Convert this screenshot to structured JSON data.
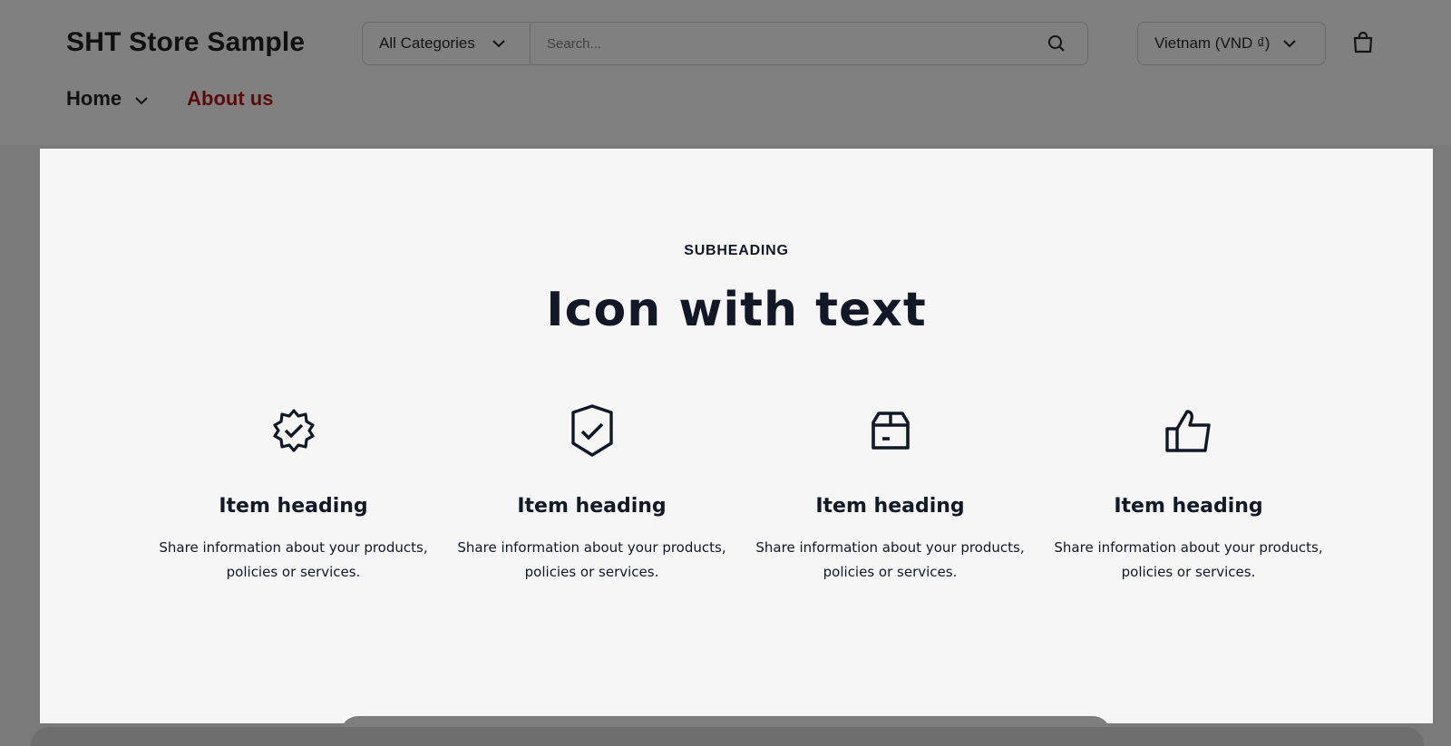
{
  "header": {
    "logo": "SHT Store Sample",
    "category_select": "All Categories",
    "search_placeholder": "Search...",
    "country_select": "Vietnam (VND ₫)",
    "nav": {
      "home": "Home",
      "about": "About us"
    }
  },
  "section": {
    "subheading": "SUBHEADING",
    "title": "Icon with text",
    "items": [
      {
        "icon": "verified-badge-icon",
        "heading": "Item heading",
        "text": "Share information about your products, policies or services."
      },
      {
        "icon": "shield-check-icon",
        "heading": "Item heading",
        "text": "Share information about your products, policies or services."
      },
      {
        "icon": "package-box-icon",
        "heading": "Item heading",
        "text": "Share information about your products, policies or services."
      },
      {
        "icon": "thumbs-up-icon",
        "heading": "Item heading",
        "text": "Share information about your products, policies or services."
      }
    ]
  },
  "colors": {
    "overlay": "#7a7a7a",
    "panel_bg": "#f6f6f6",
    "text_dark": "#121826",
    "about_link": "#5b0a0a"
  }
}
